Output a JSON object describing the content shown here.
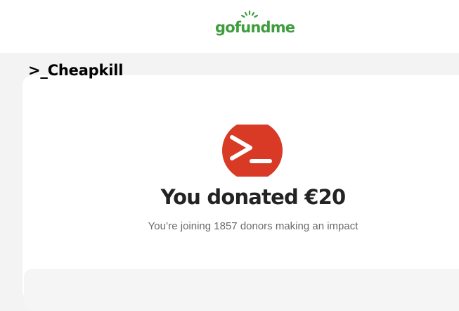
{
  "header": {
    "logo_text": "gofundme"
  },
  "overlay": {
    "title": ">_Cheapkill"
  },
  "confirmation": {
    "headline": "You donated €20",
    "subtext": "You’re joining 1857 donors making an impact",
    "avatar_icon": "terminal-prompt-icon"
  },
  "colors": {
    "brand_green": "#3f9d3e",
    "avatar_red": "#d93a25",
    "text_dark": "#232323",
    "text_muted": "#6b6b6b"
  }
}
